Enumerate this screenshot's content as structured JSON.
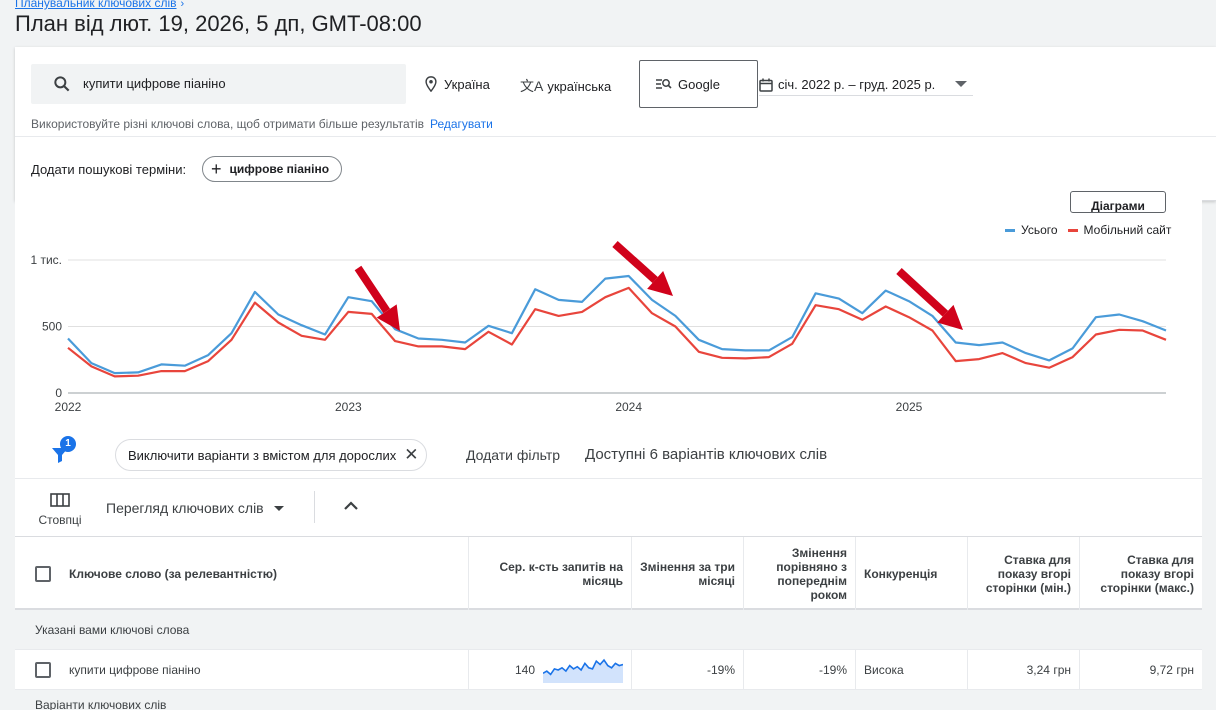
{
  "breadcrumb": "Планувальник ключових слів",
  "page_title": "План від лют. 19, 2026, 5 дп, GMT-08:00",
  "search": {
    "keyword": "купити цифрове піаніно",
    "location": "Україна",
    "language": "українська",
    "network": "Google",
    "date_range": "січ. 2022 р. – груд. 2025 р.",
    "hint": "Використовуйте різні ключові слова, щоб отримати більше результатів",
    "edit_link": "Редагувати",
    "add_terms_label": "Додати пошукові терміни:",
    "add_chip": "цифрове піаніно"
  },
  "chart_buttons": {
    "charts": "Діаграми"
  },
  "chart_data": {
    "type": "line",
    "x": [
      "2022-01",
      "2022-02",
      "2022-03",
      "2022-04",
      "2022-05",
      "2022-06",
      "2022-07",
      "2022-08",
      "2022-09",
      "2022-10",
      "2022-11",
      "2022-12",
      "2023-01",
      "2023-02",
      "2023-03",
      "2023-04",
      "2023-05",
      "2023-06",
      "2023-07",
      "2023-08",
      "2023-09",
      "2023-10",
      "2023-11",
      "2023-12",
      "2024-01",
      "2024-02",
      "2024-03",
      "2024-04",
      "2024-05",
      "2024-06",
      "2024-07",
      "2024-08",
      "2024-09",
      "2024-10",
      "2024-11",
      "2024-12",
      "2025-01",
      "2025-02",
      "2025-03",
      "2025-04",
      "2025-05",
      "2025-06",
      "2025-07",
      "2025-08",
      "2025-09",
      "2025-10",
      "2025-11",
      "2025-12"
    ],
    "x_tick_labels": [
      "2022",
      "2023",
      "2024",
      "2025"
    ],
    "y_tick_labels": [
      "0",
      "500",
      "1 тис."
    ],
    "ylim": [
      0,
      1000
    ],
    "grid": true,
    "legend_position": "top-right",
    "series": [
      {
        "name": "Усього",
        "color": "#4a9bd9",
        "values": [
          410,
          225,
          150,
          155,
          215,
          205,
          285,
          450,
          760,
          590,
          510,
          440,
          720,
          690,
          480,
          410,
          400,
          380,
          505,
          450,
          780,
          700,
          685,
          860,
          880,
          700,
          580,
          400,
          330,
          320,
          320,
          420,
          750,
          710,
          600,
          770,
          690,
          580,
          380,
          360,
          380,
          300,
          245,
          335,
          570,
          590,
          540,
          470
        ]
      },
      {
        "name": "Мобільний сайт",
        "color": "#e8453c",
        "values": [
          340,
          200,
          125,
          130,
          165,
          165,
          240,
          400,
          680,
          530,
          430,
          400,
          610,
          595,
          390,
          350,
          350,
          330,
          460,
          365,
          630,
          580,
          610,
          720,
          790,
          600,
          500,
          310,
          265,
          260,
          270,
          370,
          660,
          630,
          550,
          650,
          570,
          470,
          240,
          255,
          300,
          225,
          190,
          270,
          440,
          475,
          470,
          400
        ]
      }
    ]
  },
  "filter": {
    "badge": "1",
    "chip": "Виключити варіанти з вмістом для дорослих",
    "add_filter": "Додати фільтр",
    "available": "Доступні 6 варіантів ключових слів"
  },
  "toolbar": {
    "columns": "Стовпці",
    "view": "Перегляд ключових слів"
  },
  "table": {
    "headers": {
      "keyword": "Ключове слово (за релевантністю)",
      "avg": "Сер. к-сть запитів на місяць",
      "three_month": "Змінення за три місяці",
      "yoy": "Змінення порівняно з попереднім роком",
      "competition": "Конкуренція",
      "bid_low": "Ставка для показу вгорі сторінки (мін.)",
      "bid_high": "Ставка для показу вгорі сторінки (макс.)"
    },
    "group_label": "Указані вами ключові слова",
    "row": {
      "keyword": "купити цифрове піаніно",
      "avg": "140",
      "trend": [
        0.35,
        0.45,
        0.3,
        0.55,
        0.5,
        0.6,
        0.45,
        0.7,
        0.55,
        0.65,
        0.5,
        0.8,
        0.6,
        0.55,
        0.9,
        0.75,
        0.95,
        0.7,
        0.6,
        0.8,
        0.7,
        0.75
      ],
      "three_month": "-19%",
      "yoy": "-19%",
      "competition": "Висока",
      "bid_low": "3,24 грн",
      "bid_high": "9,72 грн"
    },
    "group_label_2": "Варіанти ключових слів"
  }
}
